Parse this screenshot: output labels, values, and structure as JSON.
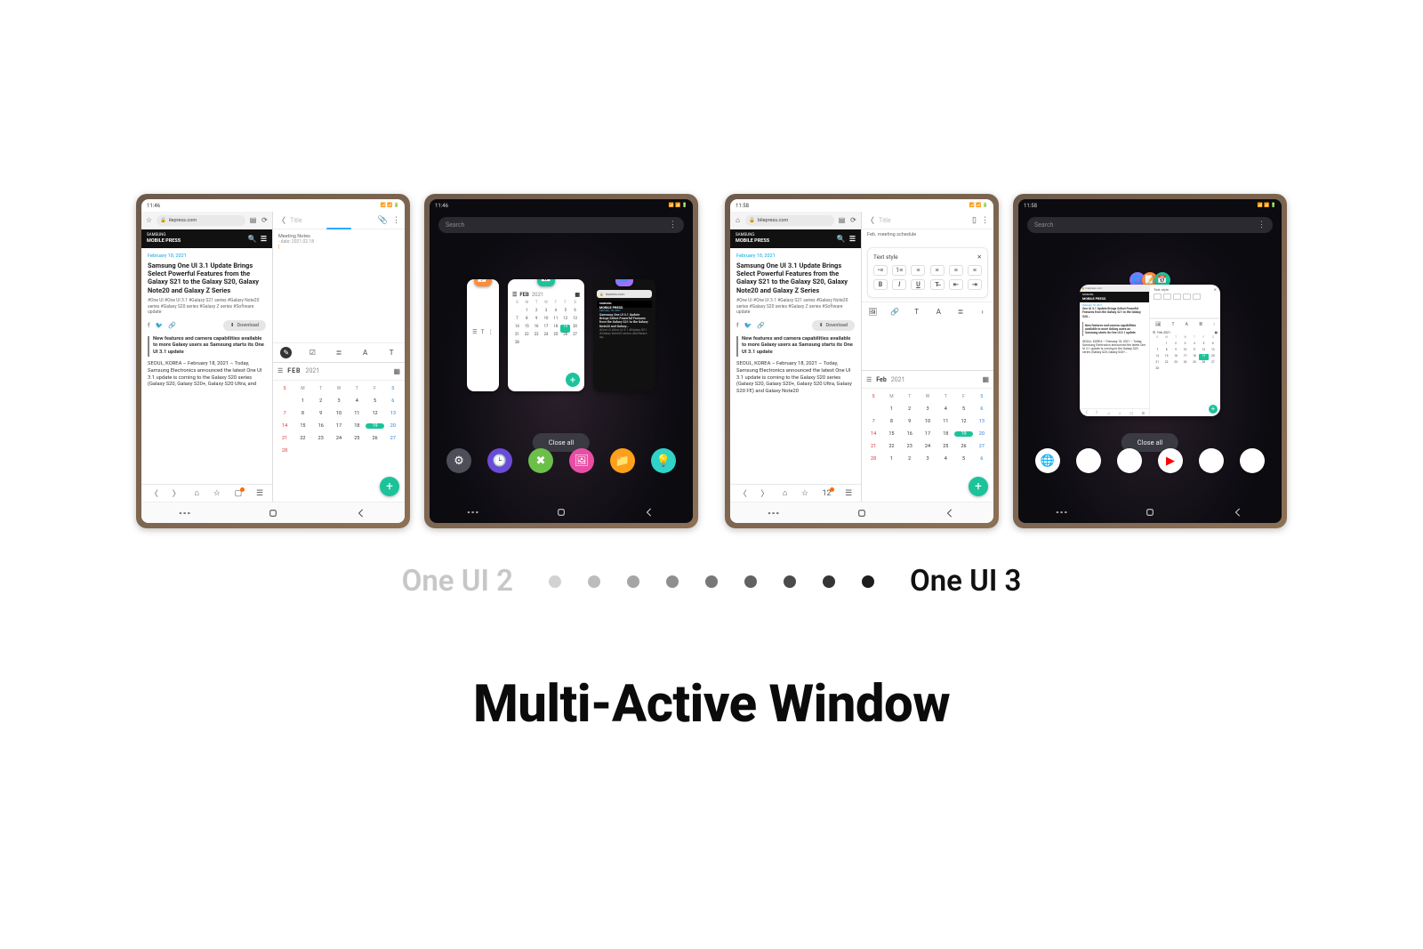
{
  "labels": {
    "left": "One UI 2",
    "right": "One UI 3"
  },
  "heading": "Multi-Active Window",
  "dots": {
    "count": 9
  },
  "device1": {
    "time": "11:46",
    "browser": {
      "url": "ilepress.com",
      "secure": true
    },
    "mobile_press": {
      "brand_small": "SAMSUNG",
      "brand": "MOBILE PRESS"
    },
    "article": {
      "date": "February 18, 2021",
      "headline": "Samsung One UI 3.1 Update Brings Select Powerful Features from the Galaxy S21 to the Galaxy S20, Galaxy Note20 and Galaxy Z Series",
      "tags": "#One UI   #One UI 3.1   #Galaxy S21 series   #Galaxy Note20 series   #Galaxy S20 series   #Galaxy Z series   #Software update",
      "download": "Download",
      "sub": "New features and camera capabilities available to more Galaxy users as Samsung starts its One UI 3.1 update",
      "body": "SEOUL, KOREA – February 18, 2021 – Today, Samsung Electronics announced the latest One UI 3.1 update is coming to the Galaxy S20 series (Galaxy S20, Galaxy S20+, Galaxy S20 Ultra, and"
    },
    "notes": {
      "title_placeholder": "Title",
      "meta_title": "Meeting Notes",
      "meta_date": "- date: 2021.02.18"
    },
    "calendar": {
      "month": "FEB",
      "year": "2021",
      "dow": [
        "S",
        "M",
        "T",
        "W",
        "T",
        "F",
        "S"
      ],
      "rows": [
        [
          "",
          "1",
          "2",
          "3",
          "4",
          "5",
          "6"
        ],
        [
          "7",
          "8",
          "9",
          "10",
          "11",
          "12",
          "13"
        ],
        [
          "14",
          "15",
          "16",
          "17",
          "18",
          "19",
          "20"
        ],
        [
          "21",
          "22",
          "23",
          "24",
          "25",
          "26",
          "27"
        ],
        [
          "28",
          "",
          "",
          "",
          "",
          "",
          ""
        ]
      ],
      "today": "19"
    }
  },
  "device2": {
    "time": "11:46",
    "search_placeholder": "Search",
    "close_all": "Close all",
    "cal_card": {
      "month": "FEB",
      "year": "2021",
      "today": "19"
    },
    "browser_card": {
      "url": "ilepress.com",
      "brand": "MOBILE PRESS",
      "date": "February 18, 2021",
      "headline": "Samsung One UI 3.1 Update Brings Select Powerful Features from the Galaxy S21 to the Galaxy Note20 and Galaxy...",
      "tags": "#One UI  #One UI 3.1  #Galaxy S21  #Galaxy Note20 series  #Software up..."
    }
  },
  "device3": {
    "time": "11:58",
    "browser": {
      "url": "bilepress.com",
      "secure": true
    },
    "mobile_press": {
      "brand_small": "SAMSUNG",
      "brand": "MOBILE PRESS"
    },
    "article": {
      "date": "February 18, 2021",
      "headline": "Samsung One UI 3.1 Update Brings Select Powerful Features from the Galaxy S21 to the Galaxy S20, Galaxy Note20 and Galaxy Z Series",
      "tags": "#One UI   #One UI 3.1   #Galaxy S21 series   #Galaxy Note20 series   #Galaxy S20 series   #Galaxy Z series   #Software update",
      "download": "Download",
      "sub": "New features and camera capabilities available to more Galaxy users as Samsung starts its One UI 3.1 update",
      "body": "SEOUL, KOREA – February 18, 2021 – Today, Samsung Electronics announced the latest One UI 3.1 update is coming to the Galaxy S20 series (Galaxy S20, Galaxy S20+, Galaxy S20 Ultra, Galaxy S20 FE) and Galaxy Note20"
    },
    "tab_count": "12",
    "notes": {
      "title_placeholder": "Title",
      "meta_title": "Feb. meeting schedule",
      "text_style_label": "Text style"
    },
    "calendar": {
      "month": "Feb",
      "year": "2021",
      "dow": [
        "S",
        "M",
        "T",
        "W",
        "T",
        "F",
        "S"
      ],
      "rows": [
        [
          "",
          "1",
          "2",
          "3",
          "4",
          "5",
          "6"
        ],
        [
          "7",
          "8",
          "9",
          "10",
          "11",
          "12",
          "13"
        ],
        [
          "14",
          "15",
          "16",
          "17",
          "18",
          "19",
          "20"
        ],
        [
          "21",
          "22",
          "23",
          "24",
          "25",
          "26",
          "27"
        ],
        [
          "28",
          "1",
          "2",
          "3",
          "4",
          "5",
          "6"
        ]
      ],
      "today": "19"
    }
  },
  "device4": {
    "time": "11:58",
    "search_placeholder": "Search",
    "close_all": "Close all",
    "group": {
      "brand": "MOBILE PRESS",
      "headline": "One UI 3.1 Update Brings Select Powerful Features from the Galaxy S21 to the Galaxy S20...",
      "sub": "New features and camera capabilities available to more Galaxy users as Samsung starts its One UI 3.1 update",
      "body": "SEOUL, KOREA – February 18, 2021 – Today, Samsung Electronics announced the latest One UI 3.1 update is coming to the Galaxy S20 series (Galaxy S20, Galaxy S20+...",
      "notes_label": "Text style",
      "cal_month": "Feb 2021",
      "today": "19"
    }
  }
}
